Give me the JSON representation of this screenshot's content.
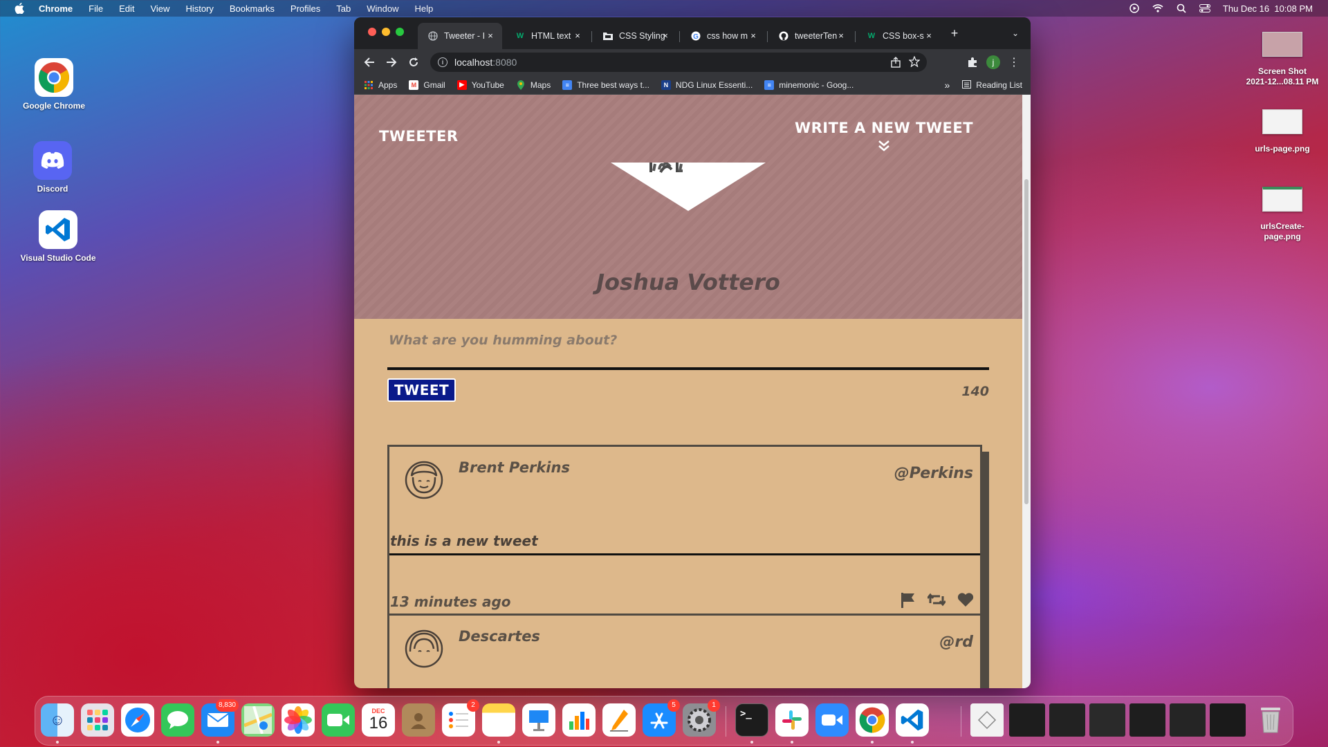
{
  "menubar": {
    "app_name": "Chrome",
    "menus": [
      "File",
      "Edit",
      "View",
      "History",
      "Bookmarks",
      "Profiles",
      "Tab",
      "Window",
      "Help"
    ],
    "clock": "Thu Dec 16  10:08 PM"
  },
  "desktop": {
    "apps": [
      {
        "label": "Google Chrome"
      },
      {
        "label": "Discord"
      },
      {
        "label": "Visual Studio Code"
      }
    ],
    "files": [
      {
        "label_line1": "Screen Shot",
        "label_line2": "2021-12...08.11 PM"
      },
      {
        "label_line1": "urls-page.png",
        "label_line2": ""
      },
      {
        "label_line1": "urlsCreate-",
        "label_line2": "page.png"
      }
    ]
  },
  "browser": {
    "tabs": [
      {
        "title": "Tweeter - I",
        "active": true,
        "icon": "globe-icon"
      },
      {
        "title": "HTML text",
        "active": false,
        "icon": "w3schools-icon"
      },
      {
        "title": "CSS Styling",
        "active": false,
        "icon": "folder-icon"
      },
      {
        "title": "css how m",
        "active": false,
        "icon": "google-icon"
      },
      {
        "title": "tweeterTen",
        "active": false,
        "icon": "github-icon"
      },
      {
        "title": "CSS box-s",
        "active": false,
        "icon": "w3schools-icon"
      }
    ],
    "url_host": "localhost",
    "url_port": ":8080",
    "profile_initial": "j",
    "bookmarks": [
      {
        "label": "Apps",
        "icon": "apps-grid-icon",
        "color": "#4285f4"
      },
      {
        "label": "Gmail",
        "icon": "gmail-icon",
        "color": "#ea4335"
      },
      {
        "label": "YouTube",
        "icon": "youtube-icon",
        "color": "#ff0000"
      },
      {
        "label": "Maps",
        "icon": "maps-icon",
        "color": "#34a853"
      },
      {
        "label": "Three best ways t...",
        "icon": "doc-icon",
        "color": "#4285f4"
      },
      {
        "label": "NDG Linux Essenti...",
        "icon": "netacad-icon",
        "color": "#1a3f8a"
      },
      {
        "label": "minemonic - Goog...",
        "icon": "doc-icon",
        "color": "#4285f4"
      }
    ],
    "overflow_label": "»",
    "reading_list": "Reading List"
  },
  "page": {
    "brand": "TWEETER",
    "compose_link": "WRITE A NEW TWEET",
    "profile_name": "Joshua Vottero",
    "composer_placeholder": "What are you humming about?",
    "tweet_button": "TWEET",
    "char_counter": "140",
    "tweets": [
      {
        "name": "Brent Perkins",
        "handle": "@Perkins",
        "content": "this is a new tweet",
        "time": "13 minutes ago"
      },
      {
        "name": "Descartes",
        "handle": "@rd",
        "content": "",
        "time": ""
      }
    ]
  },
  "dock": {
    "badges": {
      "mail": "8,830",
      "reminders": "2",
      "appstore": "5",
      "settings": "1"
    },
    "calendar_month": "DEC",
    "calendar_day": "16"
  },
  "colors": {
    "header_band": "#a97e7d",
    "page_bg": "#ddb88b",
    "tweet_button_bg": "#0a1a8a",
    "card_border": "#504a42"
  }
}
